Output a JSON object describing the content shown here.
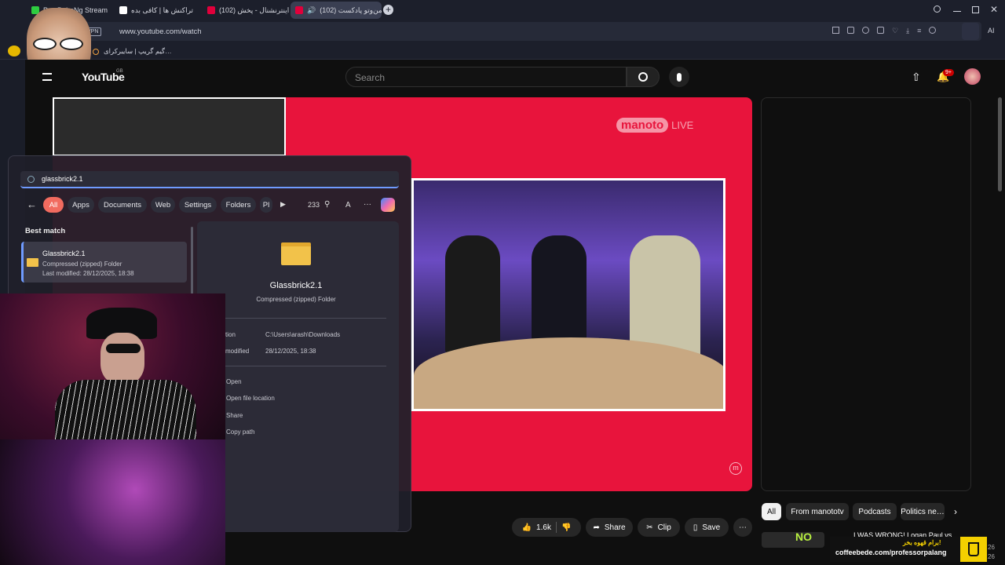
{
  "browser": {
    "tabs": [
      {
        "label": "Pr…PaLaNg Stream",
        "favicon_color": "#2ecc40",
        "active": false
      },
      {
        "label": "تراکنش ها | کافی بده",
        "favicon_color": "#ffffff",
        "active": false
      },
      {
        "label": "(102) ایران اینترنشنال - پخش",
        "favicon_color": "#e0003b",
        "active": false
      },
      {
        "label": "(102) من‌وتو پادکست |",
        "favicon_color": "#e0003b",
        "active": true
      }
    ],
    "vpn_label": "VPN",
    "url": "www.youtube.com/watch",
    "bookmark": "گیم گریپ | سایبرکرای…",
    "ai_label": "AI"
  },
  "youtube": {
    "logo_text": "YouTube",
    "region": "GB",
    "search_placeholder": "Search",
    "notif_badge": "9+",
    "channel_logo": "manoto",
    "channel_logo_live": "LIVE",
    "player_corner_icon": "m",
    "actions": {
      "likes": "1.6k",
      "share": "Share",
      "clip": "Clip",
      "save": "Save"
    },
    "chips": [
      "All",
      "From manototv",
      "Podcasts",
      "Politics ne…"
    ],
    "rec_title": "I WAS WRONG! Logan Paul vs",
    "rec_tag": "NO",
    "rec_times": [
      "26",
      "26"
    ]
  },
  "winsearch": {
    "query": "glassbrick2.1",
    "chips": [
      "All",
      "Apps",
      "Documents",
      "Web",
      "Settings",
      "Folders",
      "Pl"
    ],
    "count": "233",
    "font_letter": "A",
    "more": "···",
    "best_match_header": "Best match",
    "result": {
      "name": "Glassbrick2.1",
      "type": "Compressed (zipped) Folder",
      "modified": "Last modified: 28/12/2025, 18:38"
    },
    "detail": {
      "name": "Glassbrick2.1",
      "type": "Compressed (zipped) Folder",
      "location_label": "tion",
      "location_value": "C:\\Users\\arash\\Downloads",
      "modified_label": "modified",
      "modified_value": "28/12/2025, 18:38",
      "actions": [
        "Open",
        "Open file location",
        "Share",
        "Copy path"
      ]
    }
  },
  "overlay": {
    "coffee_text": "برام قهوه بخر!",
    "coffee_url": "coffeebede.com/professorpalang"
  },
  "colors": {
    "player_bg": "#e8143c",
    "chip_active": "#f16b5f",
    "browser_bg": "#1c1f2b"
  }
}
